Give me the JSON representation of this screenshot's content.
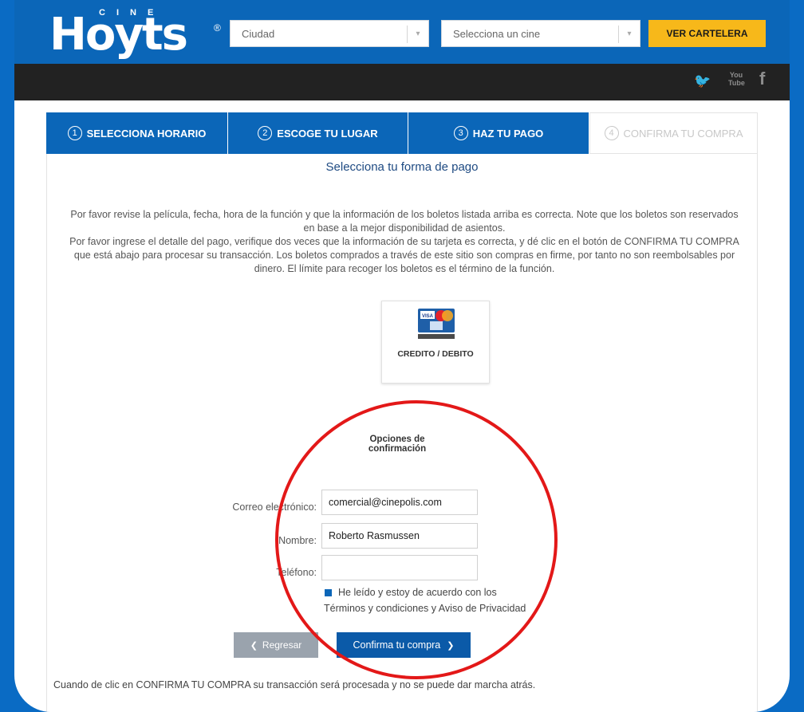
{
  "header": {
    "logo_small": "CINE",
    "logo_word": "Hoyts",
    "logo_reg": "®",
    "city_select": {
      "value": "Ciudad",
      "arrow": "▾"
    },
    "cinema_select": {
      "value": "Selecciona un cine",
      "arrow": "▾"
    },
    "cartelera_button": "VER CARTELERA"
  },
  "social": {
    "twitter": "🐦",
    "youtube": "You Tube",
    "facebook": "f"
  },
  "steps": [
    {
      "num": "1",
      "label": "SELECCIONA HORARIO"
    },
    {
      "num": "2",
      "label": "ESCOGE TU LUGAR"
    },
    {
      "num": "3",
      "label": "HAZ TU PAGO"
    },
    {
      "num": "4",
      "label": "CONFIRMA TU COMPRA"
    }
  ],
  "payment": {
    "heading": "Selecciona tu forma de pago",
    "info_1": "Por favor revise la película, fecha, hora de la función y que la información de los boletos listada arriba es correcta. Note que los boletos son reservados en base a la mejor disponibilidad de asientos.",
    "info_2": "Por favor ingrese el detalle del pago, verifique dos veces que la información de su tarjeta es correcta, y dé clic en el botón de CONFIRMA TU COMPRA que está abajo para procesar su transacción. Los boletos comprados a través de este sitio son compras en firme, por tanto no son reembolsables por dinero. El límite para recoger los boletos es el término de la función.",
    "card_label": "CREDITO / DEBITO",
    "card_visa": "VISA"
  },
  "confirm": {
    "title": "Opciones de confirmación",
    "email_label": "Correo electrónico:",
    "email_value": "comercial@cinepolis.com",
    "name_label": "Nombre:",
    "name_value": "Roberto Rasmussen",
    "phone_label": "Teléfono:",
    "phone_value": "",
    "terms_line1": "He leído y estoy de acuerdo con los",
    "terms_line2": "Términos y condiciones y Aviso de Privacidad",
    "back_button": "Regresar",
    "back_icon": "❮",
    "confirm_button": "Confirma tu compra",
    "confirm_icon": "❯"
  },
  "footer_note": "Cuando de clic en CONFIRMA TU COMPRA su transacción será procesada y no se puede dar marcha atrás.",
  "colors": {
    "brand_blue": "#0b66b8",
    "accent_yellow": "#f7b81a",
    "annotation_red": "#e31818"
  }
}
